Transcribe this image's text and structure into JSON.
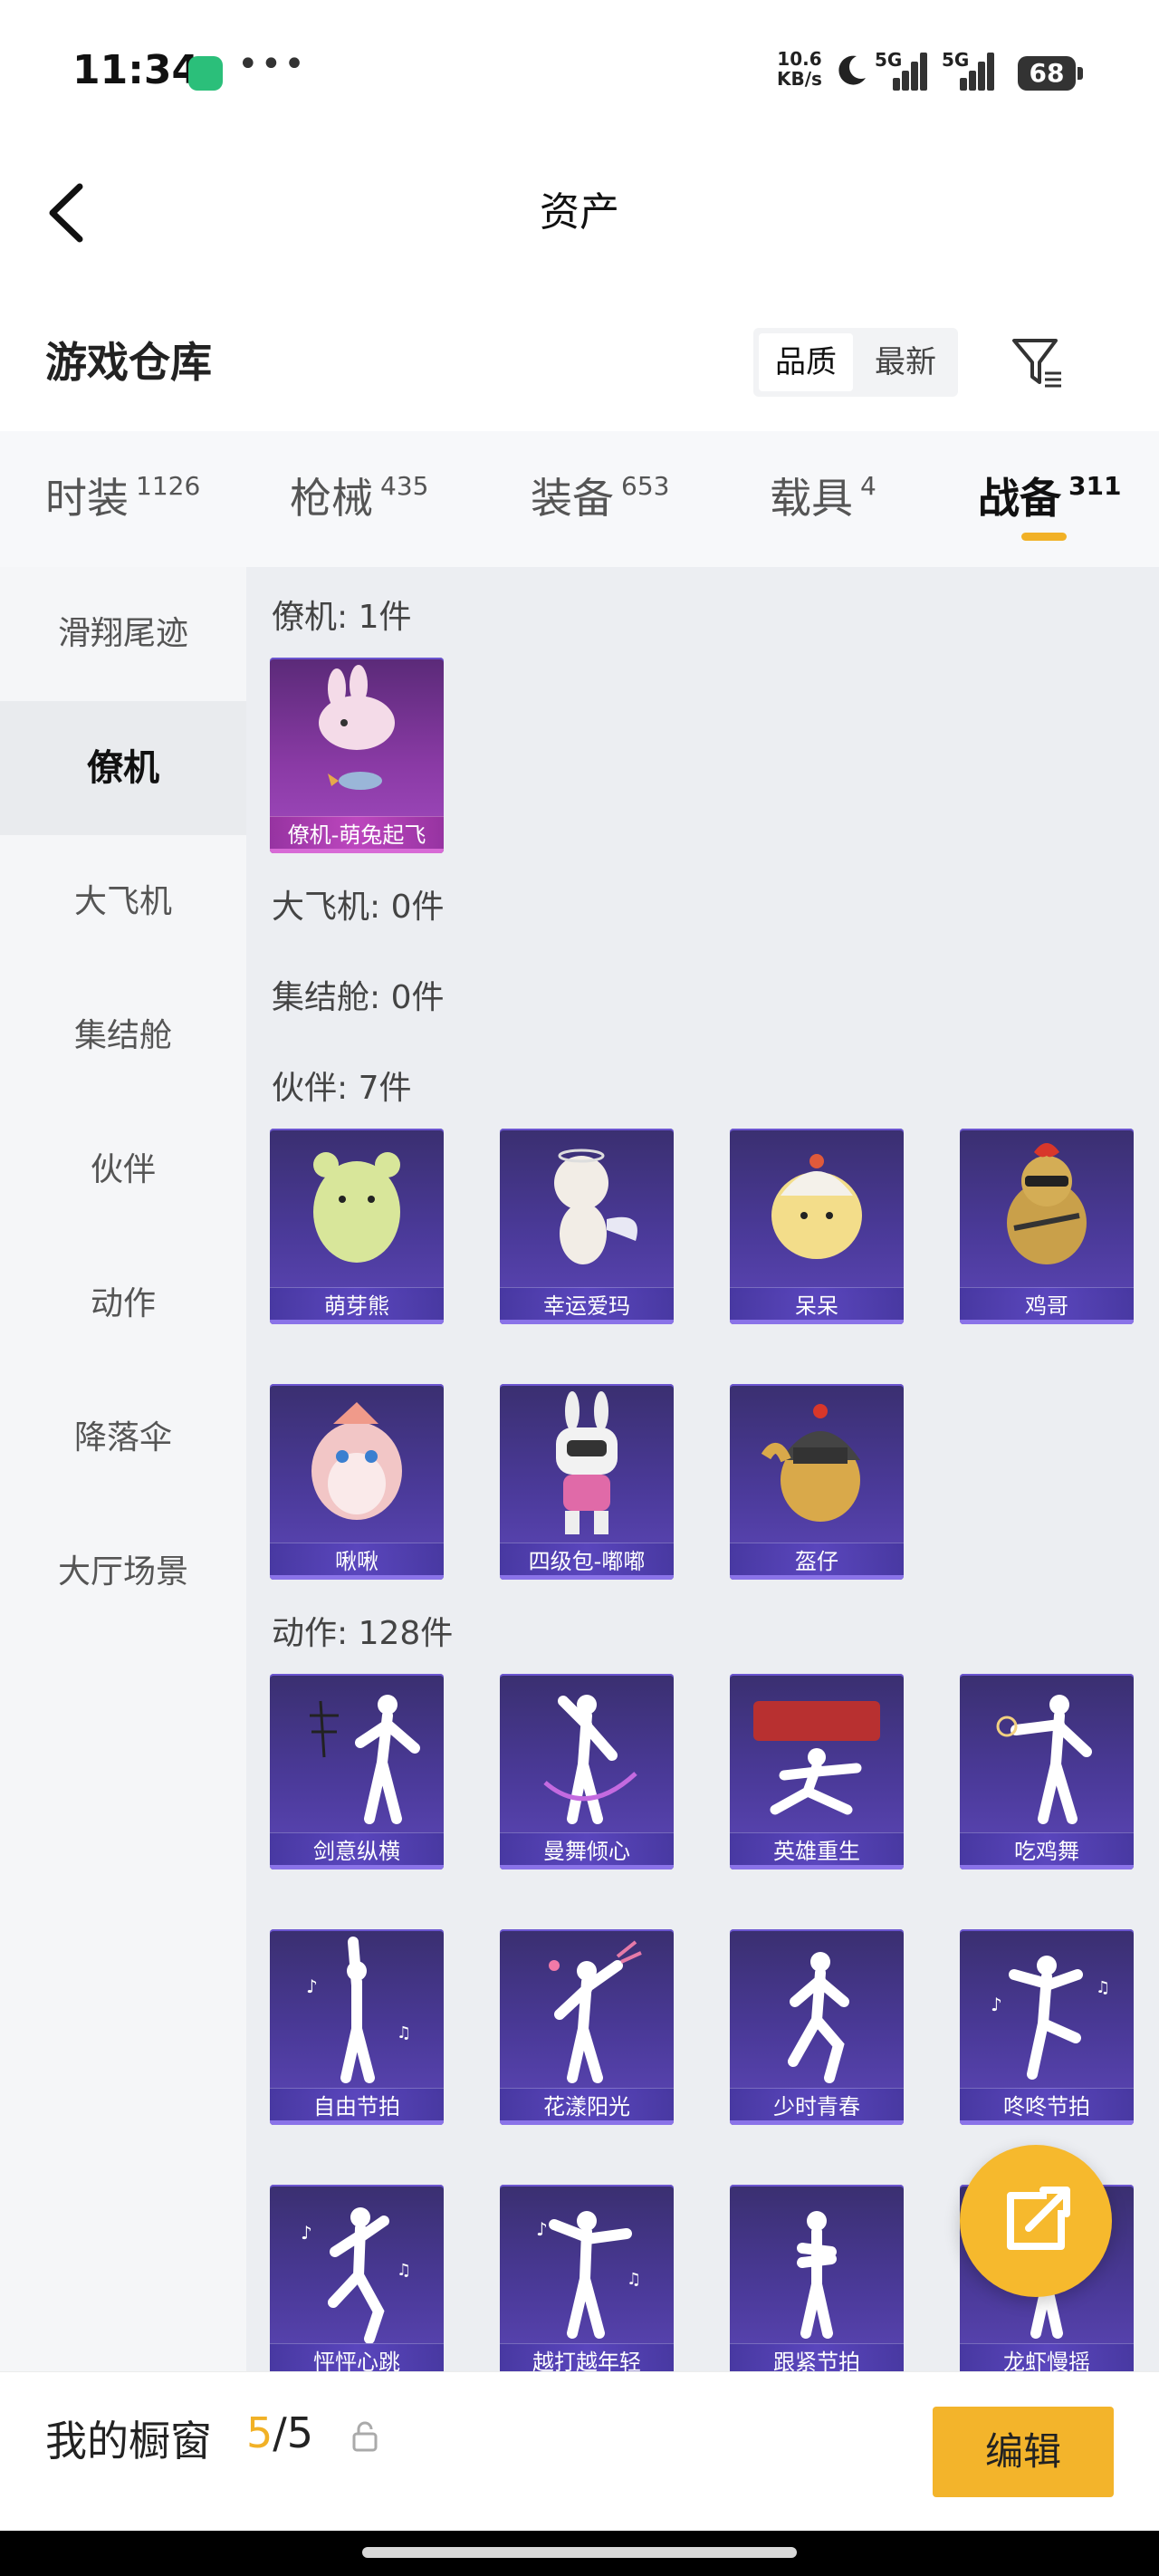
{
  "status": {
    "time": "11:34",
    "net_speed_value": "10.6",
    "net_speed_unit": "KB/s",
    "signal1": "5G",
    "signal2": "5G",
    "battery": "68"
  },
  "header": {
    "title": "资产"
  },
  "warehouse": {
    "title": "游戏仓库",
    "sort_options": [
      "品质",
      "最新"
    ],
    "selected_sort": "品质"
  },
  "tabs": [
    {
      "label": "时装",
      "count": "1126"
    },
    {
      "label": "枪械",
      "count": "435"
    },
    {
      "label": "装备",
      "count": "653"
    },
    {
      "label": "载具",
      "count": "4"
    },
    {
      "label": "战备",
      "count": "311"
    }
  ],
  "active_tab": "战备",
  "sidebar": {
    "items": [
      "滑翔尾迹",
      "僚机",
      "大飞机",
      "集结舱",
      "伙伴",
      "动作",
      "降落伞",
      "大厅场景"
    ],
    "active": "僚机"
  },
  "sections": {
    "wingman": {
      "title": "僚机: 1件",
      "items": [
        "僚机-萌兔起飞"
      ]
    },
    "big_plane": {
      "title": "大飞机: 0件"
    },
    "assembly_pod": {
      "title": "集结舱: 0件"
    },
    "partners": {
      "title": "伙伴: 7件",
      "items": [
        "萌芽熊",
        "幸运爱玛",
        "呆呆",
        "鸡哥",
        "啾啾",
        "四级包-嘟嘟",
        "盔仔"
      ]
    },
    "emotes": {
      "title": "动作: 128件",
      "items": [
        "剑意纵横",
        "曼舞倾心",
        "英雄重生",
        "吃鸡舞",
        "自由节拍",
        "花漾阳光",
        "少时青春",
        "咚咚节拍",
        "怦怦心跳",
        "越打越年轻",
        "跟紧节拍",
        "龙虾慢摇"
      ]
    }
  },
  "showcase": {
    "label": "我的橱窗",
    "count_current": "5",
    "count_total": "/5",
    "edit_label": "编辑"
  },
  "colors": {
    "accent": "#f1b126",
    "card_purple": "#4b3a9a",
    "card_pink": "#a24bc0"
  },
  "icons": {
    "back": "chevron-left-icon",
    "filter": "filter-icon",
    "share": "share-external-icon",
    "lock": "lock-icon"
  }
}
